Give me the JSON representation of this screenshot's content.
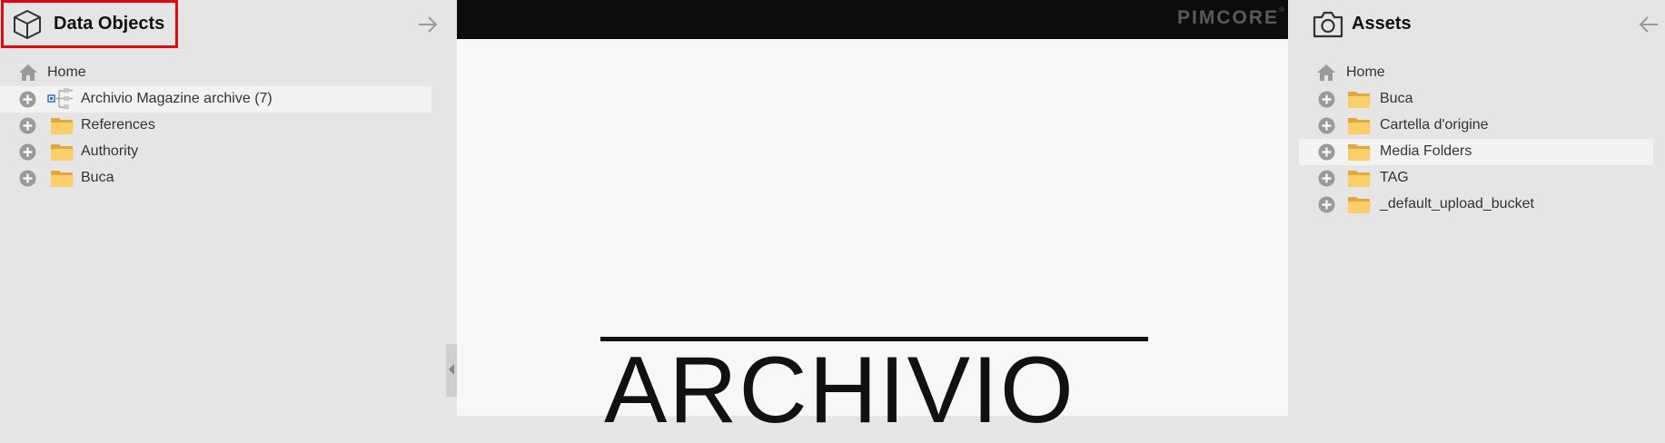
{
  "left_panel": {
    "title": "Data Objects",
    "icon": "cube-icon",
    "collapse_icon": "arrow-right-icon",
    "tree": [
      {
        "label": "Home",
        "icon": "home-icon"
      },
      {
        "label": "Archivio Magazine archive (7)",
        "icon": "object-tree-icon",
        "selected": true
      },
      {
        "label": "References",
        "icon": "folder-icon"
      },
      {
        "label": "Authority",
        "icon": "folder-icon"
      },
      {
        "label": "Buca",
        "icon": "folder-icon"
      }
    ]
  },
  "center_panel": {
    "brand": "PIMCORE",
    "brand_mark": "®",
    "preview_text": "ARCHIVIO"
  },
  "right_panel": {
    "title": "Assets",
    "icon": "camera-icon",
    "collapse_icon": "arrow-left-icon",
    "tree": [
      {
        "label": "Home",
        "icon": "home-icon"
      },
      {
        "label": "Buca",
        "icon": "folder-icon"
      },
      {
        "label": "Cartella d'origine",
        "icon": "folder-icon"
      },
      {
        "label": "Media Folders",
        "icon": "folder-icon",
        "selected": true
      },
      {
        "label": "TAG",
        "icon": "folder-icon"
      },
      {
        "label": "_default_upload_bucket",
        "icon": "folder-icon"
      }
    ]
  },
  "colors": {
    "highlight": "#e30613",
    "folder": "#f8cf6a",
    "icon_gray": "#9a9a9a",
    "topbar": "#0c0c0e"
  }
}
